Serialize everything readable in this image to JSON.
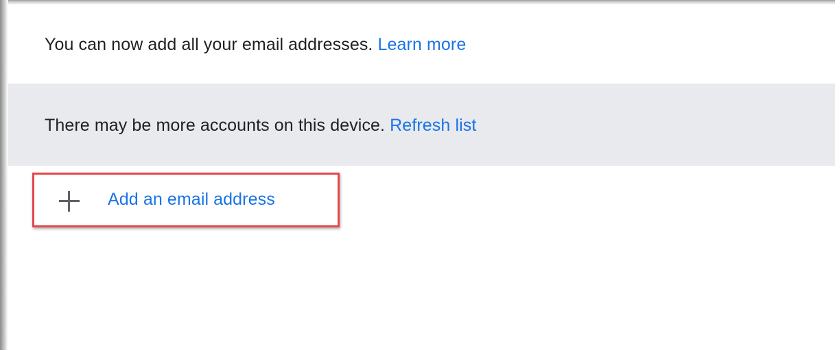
{
  "info": {
    "message": "You can now add all your email addresses.",
    "link": "Learn more"
  },
  "notice": {
    "message": "There may be more accounts on this device.",
    "link": "Refresh list"
  },
  "add_account": {
    "icon": "plus-icon",
    "label": "Add an email address"
  },
  "colors": {
    "link": "#1a73e8",
    "notice_background": "#e8eaed",
    "highlight_border": "#e5474c",
    "icon": "#5f6368"
  }
}
